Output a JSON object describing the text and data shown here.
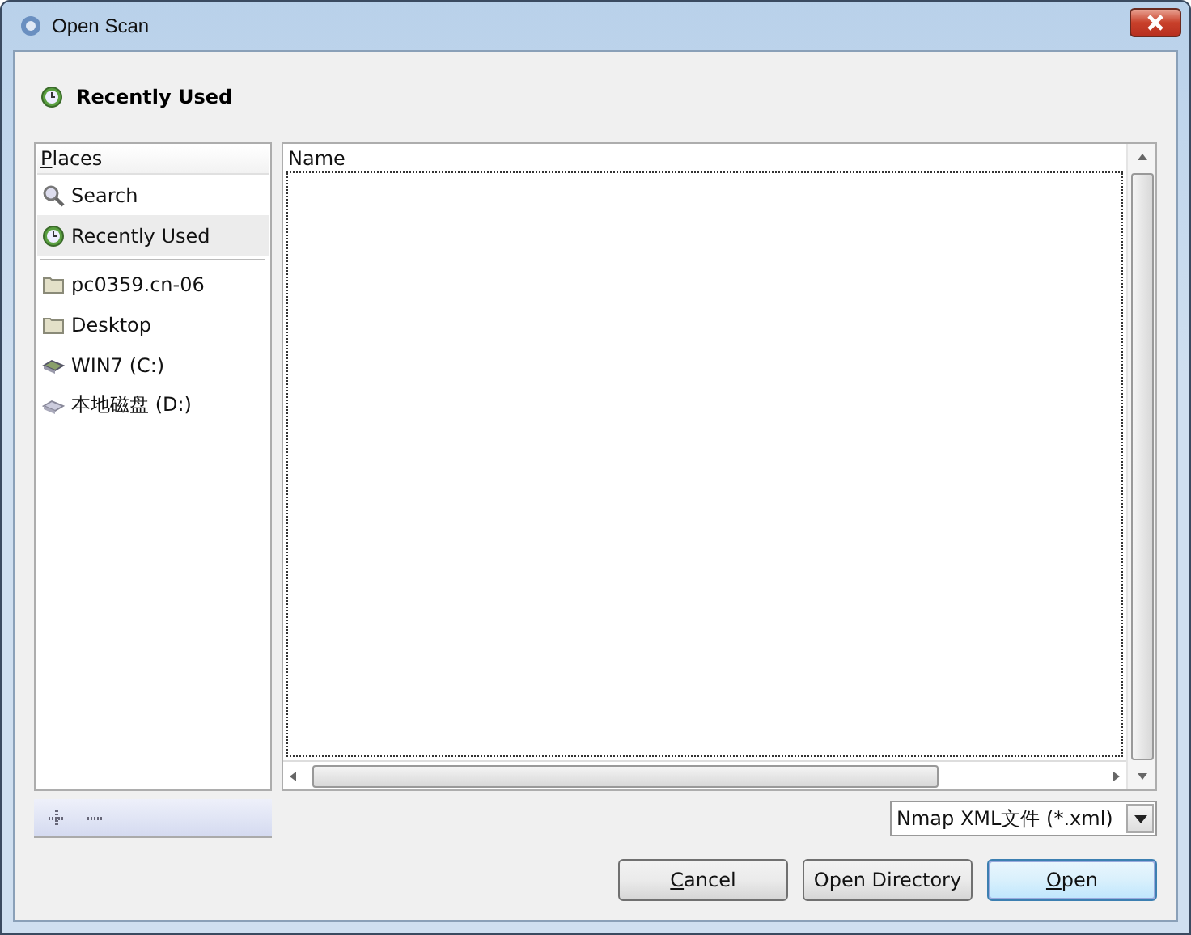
{
  "window": {
    "title": "Open Scan"
  },
  "path_bar": {
    "button": {
      "label": "Recently Used",
      "kind": "recent"
    }
  },
  "places": {
    "heading": "Places",
    "access_key_underlined": true,
    "items": [
      {
        "label": "Search",
        "kind": "search",
        "selected": false,
        "separator_after": false
      },
      {
        "label": "Recently Used",
        "kind": "recent",
        "selected": true,
        "separator_after": true
      },
      {
        "label": "pc0359.cn-06",
        "kind": "folder",
        "selected": false,
        "separator_after": false
      },
      {
        "label": "Desktop",
        "kind": "folder",
        "selected": false,
        "separator_after": false
      },
      {
        "label": "WIN7 (C:)",
        "kind": "system-drive",
        "selected": false,
        "separator_after": false
      },
      {
        "label": "本地磁盘 (D:)",
        "kind": "drive",
        "selected": false,
        "separator_after": false
      }
    ]
  },
  "file_list": {
    "columns": [
      "Name"
    ]
  },
  "filter": {
    "value": "Nmap XML文件 (*.xml)"
  },
  "buttons": [
    {
      "label": "Cancel",
      "access_key_underlined": true,
      "default": false
    },
    {
      "label": "Open Directory",
      "access_key_underlined": false,
      "default": false
    },
    {
      "label": "Open",
      "access_key_underlined": true,
      "default": true
    }
  ]
}
